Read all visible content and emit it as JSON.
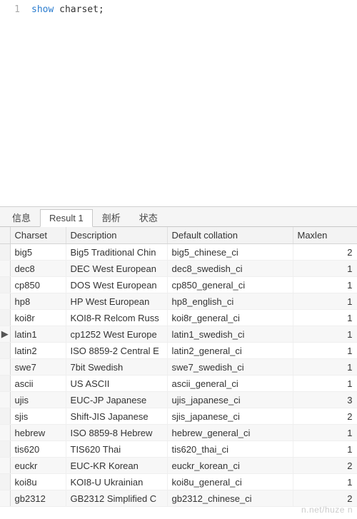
{
  "editor": {
    "line_number": "1",
    "keyword": "show",
    "rest": " charset;"
  },
  "tabs": {
    "items": [
      {
        "label": "信息"
      },
      {
        "label": "Result 1"
      },
      {
        "label": "剖析"
      },
      {
        "label": "状态"
      }
    ],
    "active_index": 1
  },
  "grid": {
    "columns": [
      "Charset",
      "Description",
      "Default collation",
      "Maxlen"
    ],
    "current_row_index": 5,
    "rows": [
      {
        "charset": "big5",
        "description": "Big5 Traditional Chin",
        "collation": "big5_chinese_ci",
        "maxlen": "2"
      },
      {
        "charset": "dec8",
        "description": "DEC West European",
        "collation": "dec8_swedish_ci",
        "maxlen": "1"
      },
      {
        "charset": "cp850",
        "description": "DOS West European",
        "collation": "cp850_general_ci",
        "maxlen": "1"
      },
      {
        "charset": "hp8",
        "description": "HP West European",
        "collation": "hp8_english_ci",
        "maxlen": "1"
      },
      {
        "charset": "koi8r",
        "description": "KOI8-R Relcom Russ",
        "collation": "koi8r_general_ci",
        "maxlen": "1"
      },
      {
        "charset": "latin1",
        "description": "cp1252 West Europe",
        "collation": "latin1_swedish_ci",
        "maxlen": "1"
      },
      {
        "charset": "latin2",
        "description": "ISO 8859-2 Central E",
        "collation": "latin2_general_ci",
        "maxlen": "1"
      },
      {
        "charset": "swe7",
        "description": "7bit Swedish",
        "collation": "swe7_swedish_ci",
        "maxlen": "1"
      },
      {
        "charset": "ascii",
        "description": "US ASCII",
        "collation": "ascii_general_ci",
        "maxlen": "1"
      },
      {
        "charset": "ujis",
        "description": "EUC-JP Japanese",
        "collation": "ujis_japanese_ci",
        "maxlen": "3"
      },
      {
        "charset": "sjis",
        "description": "Shift-JIS Japanese",
        "collation": "sjis_japanese_ci",
        "maxlen": "2"
      },
      {
        "charset": "hebrew",
        "description": "ISO 8859-8 Hebrew",
        "collation": "hebrew_general_ci",
        "maxlen": "1"
      },
      {
        "charset": "tis620",
        "description": "TIS620 Thai",
        "collation": "tis620_thai_ci",
        "maxlen": "1"
      },
      {
        "charset": "euckr",
        "description": "EUC-KR Korean",
        "collation": "euckr_korean_ci",
        "maxlen": "2"
      },
      {
        "charset": "koi8u",
        "description": "KOI8-U Ukrainian",
        "collation": "koi8u_general_ci",
        "maxlen": "1"
      },
      {
        "charset": "gb2312",
        "description": "GB2312 Simplified C",
        "collation": "gb2312_chinese_ci",
        "maxlen": "2"
      }
    ]
  },
  "watermark": "n.net/huze     n"
}
